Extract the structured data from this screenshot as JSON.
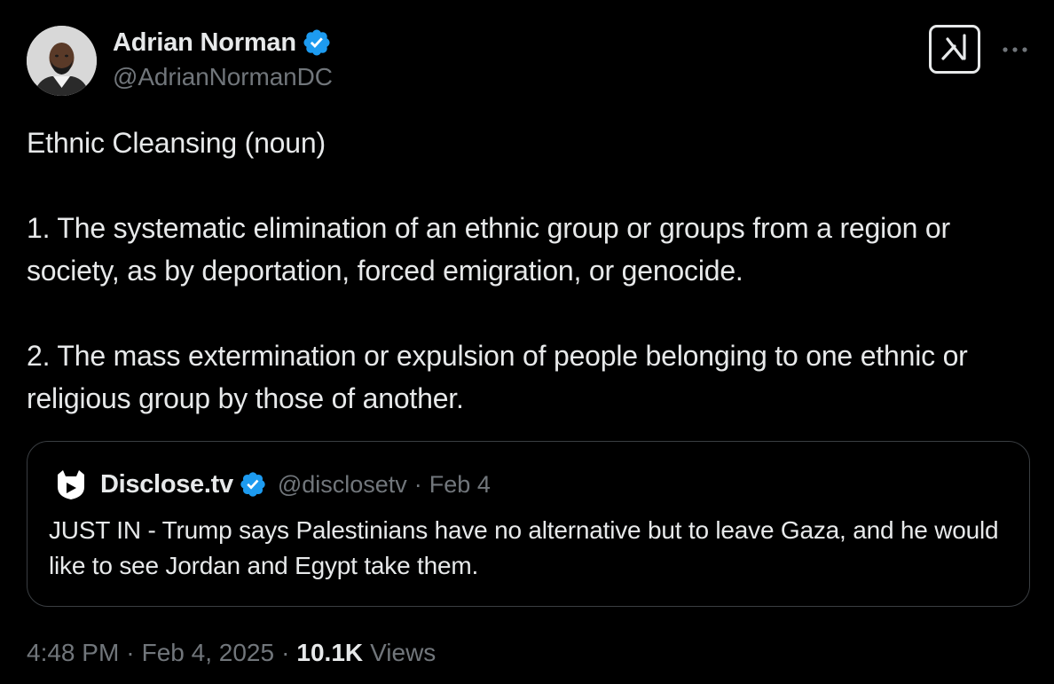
{
  "author": {
    "name": "Adrian Norman",
    "handle": "@AdrianNormanDC",
    "verified_color": "#1d9bf0"
  },
  "header_actions": {
    "grok_icon": "grok-icon",
    "more_icon": "more-icon"
  },
  "tweet": {
    "paragraphs": [
      "Ethnic Cleansing (noun)",
      "1. The systematic elimination of an ethnic group or groups from a region or society, as by deportation, forced emigration, or genocide.",
      "2. The mass extermination or expulsion of people belonging to one ethnic or religious group by those of another."
    ]
  },
  "quote": {
    "name": "Disclose.tv",
    "handle": "@disclosetv",
    "separator": "·",
    "date": "Feb 4",
    "text": "JUST IN - Trump says Palestinians have no alternative but to leave Gaza, and he would like to see Jordan and Egypt take them."
  },
  "footer": {
    "time": "4:48 PM",
    "sep1": "·",
    "date": "Feb 4, 2025",
    "sep2": "·",
    "views_count": "10.1K",
    "views_label": "Views"
  },
  "colors": {
    "background": "#000000",
    "text": "#e7e9ea",
    "muted": "#71767b",
    "border": "#3a3e42",
    "verified": "#1d9bf0"
  }
}
